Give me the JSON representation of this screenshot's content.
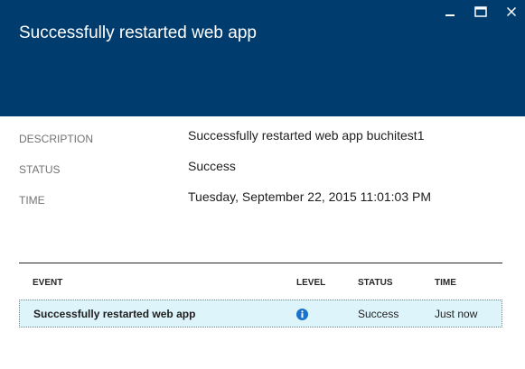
{
  "header": {
    "title": "Successfully restarted web app",
    "background_color": "#003c6e",
    "controls": [
      {
        "name": "minimize",
        "icon": "minimize-icon"
      },
      {
        "name": "maximize",
        "icon": "maximize-icon"
      },
      {
        "name": "close",
        "icon": "close-icon"
      }
    ]
  },
  "properties": {
    "description": {
      "label": "DESCRIPTION",
      "value": "Successfully restarted web app buchitest1"
    },
    "status": {
      "label": "STATUS",
      "value": "Success"
    },
    "time": {
      "label": "TIME",
      "value": "Tuesday, September 22, 2015 11:01:03 PM"
    }
  },
  "events_grid": {
    "columns": [
      "EVENT",
      "LEVEL",
      "STATUS",
      "TIME"
    ],
    "rows": [
      {
        "event": "Successfully restarted web app",
        "level_icon": "info-icon",
        "status": "Success",
        "time": "Just now"
      }
    ],
    "selected_row_color": "#ddf4fb",
    "info_icon_color": "#1a73c9"
  }
}
